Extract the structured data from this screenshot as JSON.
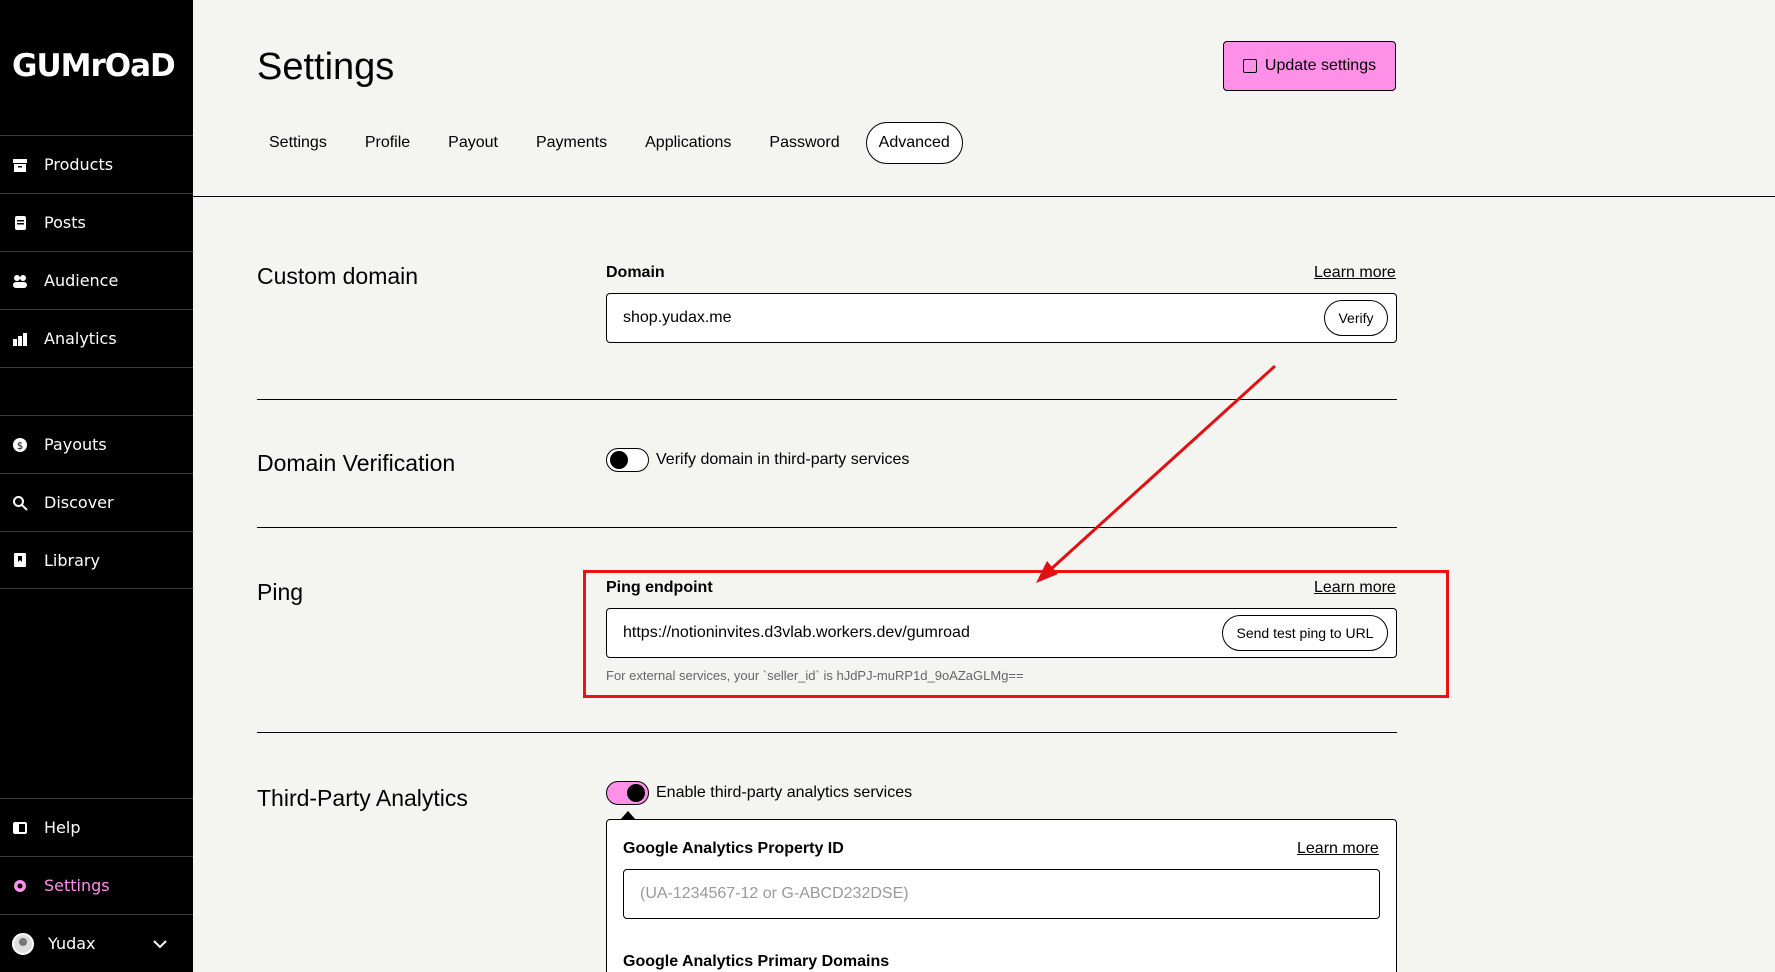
{
  "sidebar": {
    "logo": "GUMrOaD",
    "items": [
      {
        "label": "Products",
        "icon": "archive-icon"
      },
      {
        "label": "Posts",
        "icon": "document-icon"
      },
      {
        "label": "Audience",
        "icon": "people-icon"
      },
      {
        "label": "Analytics",
        "icon": "bar-chart-icon"
      },
      {
        "label": "",
        "icon": ""
      },
      {
        "label": "Payouts",
        "icon": "dollar-circle-icon"
      },
      {
        "label": "Discover",
        "icon": "search-icon"
      },
      {
        "label": "Library",
        "icon": "bookmark-icon"
      }
    ],
    "bottom": [
      {
        "label": "Help",
        "icon": "book-icon"
      },
      {
        "label": "Settings",
        "icon": "gear-icon"
      },
      {
        "label": "Yudax",
        "icon": "avatar"
      }
    ]
  },
  "header": {
    "title": "Settings",
    "update_label": "Update settings",
    "tabs": [
      "Settings",
      "Profile",
      "Payout",
      "Payments",
      "Applications",
      "Password",
      "Advanced"
    ],
    "active_tab": "Advanced"
  },
  "custom_domain": {
    "title": "Custom domain",
    "label": "Domain",
    "learn_more": "Learn more",
    "value": "shop.yudax.me",
    "verify_label": "Verify"
  },
  "domain_verification": {
    "title": "Domain Verification",
    "toggle_label": "Verify domain in third-party services",
    "enabled": false
  },
  "ping": {
    "title": "Ping",
    "label": "Ping endpoint",
    "learn_more": "Learn more",
    "value": "https://notioninvites.d3vlab.workers.dev/gumroad",
    "send_label": "Send test ping to URL",
    "help": "For external services, your `seller_id` is hJdPJ-muRP1d_9oAZaGLMg=="
  },
  "third_party": {
    "title": "Third-Party Analytics",
    "toggle_label": "Enable third-party analytics services",
    "enabled": true,
    "ga_label": "Google Analytics Property ID",
    "ga_learn_more": "Learn more",
    "ga_placeholder": "(UA-1234567-12 or G-ABCD232DSE)",
    "ga_domains_label": "Google Analytics Primary Domains"
  },
  "colors": {
    "accent": "#ff90e8",
    "annotation": "#e11111"
  }
}
